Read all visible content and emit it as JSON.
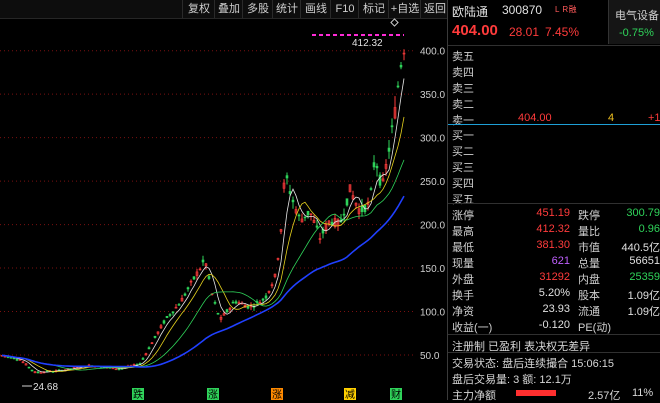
{
  "toolbar": [
    "复权",
    "叠加",
    "多股",
    "统计",
    "画线",
    "F10",
    "标记",
    "+自选",
    "返回"
  ],
  "chart": {
    "high_label": "412.32",
    "low_label": "24.68",
    "y_ticks": [
      "400.0",
      "350.0",
      "300.0",
      "250.0",
      "200.0",
      "150.0",
      "100.0",
      "50.0"
    ],
    "bottom_markers": [
      "跌",
      "涨",
      "涨",
      "减",
      "财"
    ],
    "colors": {
      "up": "#ff3b3b",
      "down": "#2fd35a",
      "ma_white": "#e8e8e8",
      "ma_yellow": "#e6d21e",
      "ma_green": "#2fd35a",
      "ma_blue": "#2040ff",
      "marker": "#ff2bd6"
    }
  },
  "quote": {
    "name": "欧陆通",
    "code": "300870",
    "flags": "L R融",
    "price": "404.00",
    "change": "28.01",
    "change_pct": "7.45%",
    "sector": "电气设备",
    "sector_change": "-0.75%"
  },
  "order_book": {
    "sell": [
      {
        "label": "卖五",
        "price": "",
        "vol": ""
      },
      {
        "label": "卖四",
        "price": "",
        "vol": ""
      },
      {
        "label": "卖三",
        "price": "",
        "vol": ""
      },
      {
        "label": "卖二",
        "price": "",
        "vol": ""
      },
      {
        "label": "卖一",
        "price": "404.00",
        "vol": "4",
        "delta": "+1"
      }
    ],
    "buy": [
      {
        "label": "买一"
      },
      {
        "label": "买二"
      },
      {
        "label": "买三"
      },
      {
        "label": "买四"
      },
      {
        "label": "买五"
      }
    ]
  },
  "stats": [
    {
      "l1": "涨停",
      "v1": "451.19",
      "l2": "跌停",
      "v2": "300.79"
    },
    {
      "l1": "最高",
      "v1": "412.32",
      "l2": "量比",
      "v2": "0.96"
    },
    {
      "l1": "最低",
      "v1": "381.30",
      "l2": "市值",
      "v2": "440.5亿"
    },
    {
      "l1": "现量",
      "v1": "621",
      "l2": "总量",
      "v2": "56651"
    },
    {
      "l1": "外盘",
      "v1": "31292",
      "l2": "内盘",
      "v2": "25359"
    },
    {
      "l1": "换手",
      "v1": "5.20%",
      "l2": "股本",
      "v2": "1.09亿"
    },
    {
      "l1": "净资",
      "v1": "23.93",
      "l2": "流通",
      "v2": "1.09亿"
    },
    {
      "l1": "收益(一)",
      "v1": "-0.120",
      "l2": "PE(动)",
      "v2": ""
    }
  ],
  "status": {
    "line1": "注册制 已盈利 表决权无差异",
    "line2": "交易状态: 盘后连续撮合 15:06:15",
    "line3": "盘后交易量: 3  额: 12.1万",
    "flow_label": "主力净额",
    "flow_value": "2.57亿",
    "flow_pct": "11%"
  }
}
